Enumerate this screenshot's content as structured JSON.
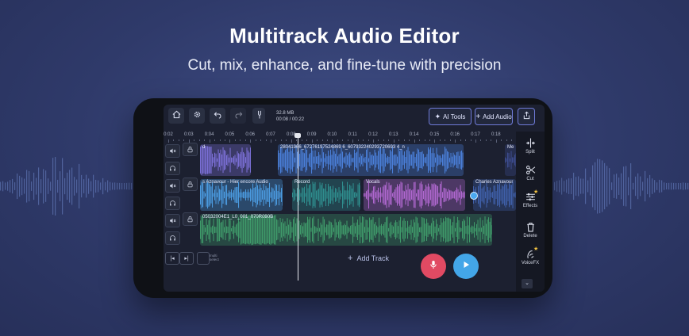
{
  "promo": {
    "headline": "Multitrack Audio Editor",
    "subhead": "Cut, mix, enhance, and fine-tune with precision"
  },
  "toolbar": {
    "home_icon": "home-icon",
    "settings_icon": "gear-icon",
    "undo_icon": "undo-icon",
    "redo_icon": "redo-icon",
    "tuning_icon": "tuning-fork-icon",
    "file_size": "32.8 MB",
    "time": "00:08 / 00:22",
    "ai_tools_label": "AI Tools",
    "add_audio_label": "Add Audio",
    "share_icon": "share-icon"
  },
  "timeline": {
    "ruler": [
      "0:02",
      "0:03",
      "0:04",
      "0:05",
      "0:06",
      "0:07",
      "0:08",
      "0:09",
      "0:10",
      "0:11",
      "0:12",
      "0:13",
      "0:14",
      "0:15",
      "0:16",
      "0:17",
      "0:18"
    ],
    "playhead_time": "0:08"
  },
  "tracks": [
    {
      "mute_icon": "mute-icon",
      "lock_icon": "lock-icon",
      "headphones_icon": "headphones-icon",
      "clips": [
        {
          "name": "d",
          "color": "#7b6fd6"
        },
        {
          "name": "28041966_67276197524869 6_607932240293720693 4_n",
          "color": "#4a7fd8"
        },
        {
          "name": "Me",
          "color": "#3d4c8e"
        }
      ]
    },
    {
      "mute_icon": "mute-icon",
      "lock_icon": "lock-icon",
      "headphones_icon": "headphones-icon",
      "clips": [
        {
          "name": "s Aznavour - Hier encore Audio",
          "color": "#4b9be0"
        },
        {
          "name": "Record",
          "color": "#2f8e8e"
        },
        {
          "name": "Vocals",
          "color": "#b068d0"
        },
        {
          "name": "Charles Aznavour",
          "color": "#3f5fa8"
        }
      ]
    },
    {
      "mute_icon": "mute-icon",
      "lock_icon": "lock-icon",
      "headphones_icon": "headphones-icon",
      "clips": [
        {
          "name": "05032004E1_L0_001_070R090B",
          "color": "#3f9a6a"
        }
      ]
    }
  ],
  "bottom": {
    "skip_start_icon": "skip-start-icon",
    "skip_end_icon": "skip-end-icon",
    "multi_select_label": "multi select",
    "add_track_label": "Add Track",
    "record_icon": "microphone-icon",
    "play_icon": "play-icon"
  },
  "tools": [
    {
      "label": "Split",
      "icon": "split-icon"
    },
    {
      "label": "Cut",
      "icon": "scissors-icon"
    },
    {
      "label": "Effects",
      "icon": "sliders-icon",
      "premium": true
    },
    {
      "label": "Delete",
      "icon": "trash-icon"
    },
    {
      "label": "VoiceFX",
      "icon": "voice-icon",
      "premium": true
    }
  ],
  "colors": {
    "accent": "#6f7bd8",
    "record": "#e14a63",
    "play": "#43a6e8",
    "premium_star": "#f5c542"
  }
}
